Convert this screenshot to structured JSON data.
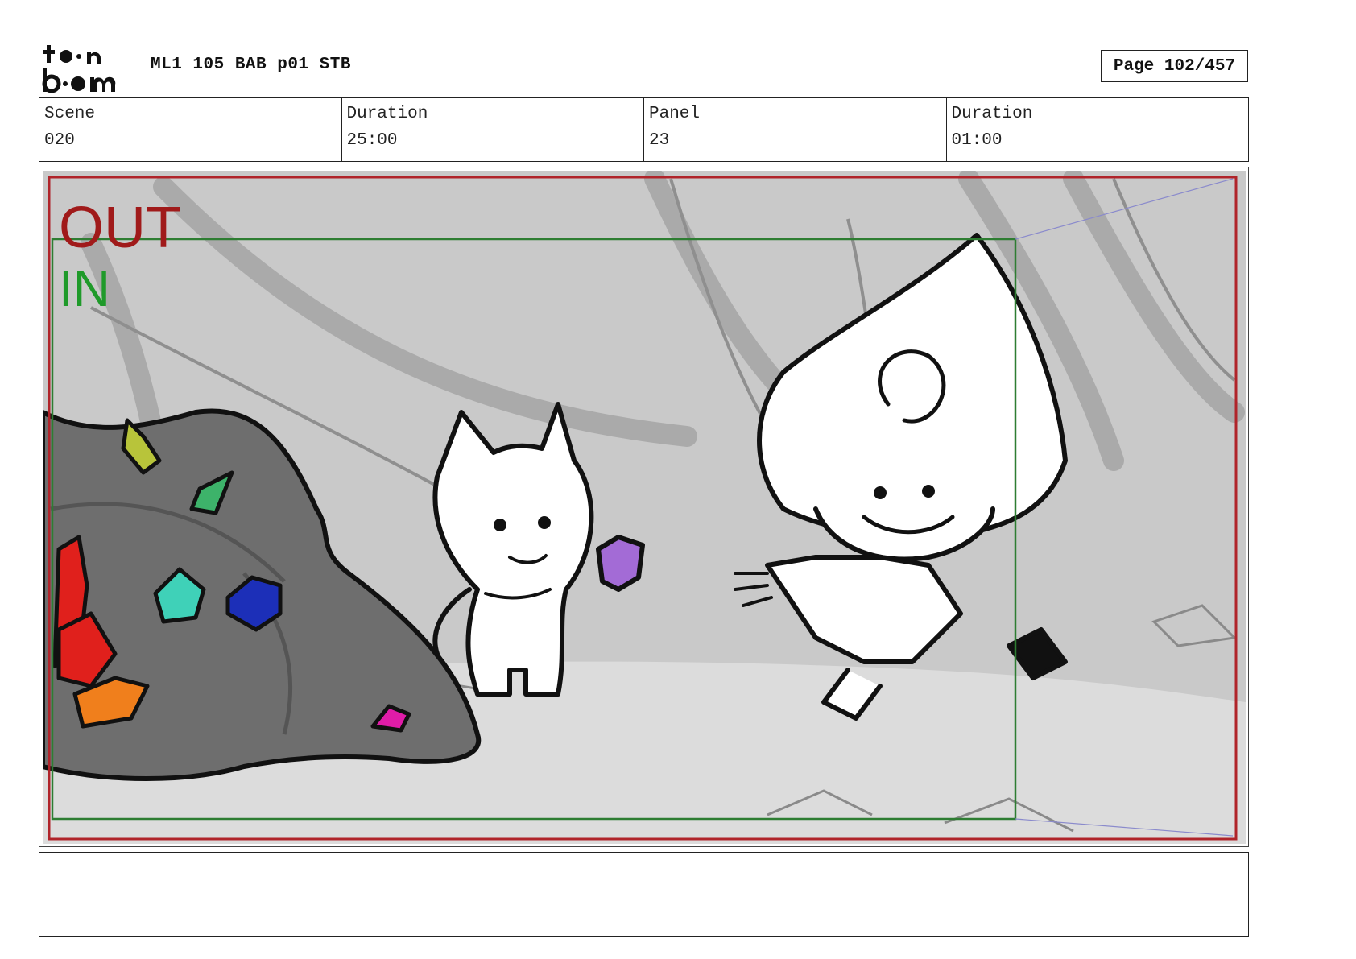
{
  "header": {
    "logo_text": "toon boom",
    "document_title": "ML1 105 BAB p01 STB",
    "page_label": "Page 102/457"
  },
  "info_cells": [
    {
      "label": "Scene",
      "value": "020"
    },
    {
      "label": "Duration",
      "value": "25:00"
    },
    {
      "label": "Panel",
      "value": "23"
    },
    {
      "label": "Duration",
      "value": "01:00"
    }
  ],
  "panel": {
    "out_label": "OUT",
    "in_label": "IN",
    "colors": {
      "out_frame": "#b0242a",
      "in_frame": "#2e7d32",
      "out_text": "#a01a1a",
      "in_text": "#1f9a2a",
      "rock": "#6e6e6e",
      "background": "#c8c8c8"
    },
    "crystals": [
      "yellow-green",
      "green",
      "red",
      "orange",
      "teal",
      "blue",
      "magenta",
      "purple"
    ]
  },
  "caption": {
    "text": ""
  }
}
